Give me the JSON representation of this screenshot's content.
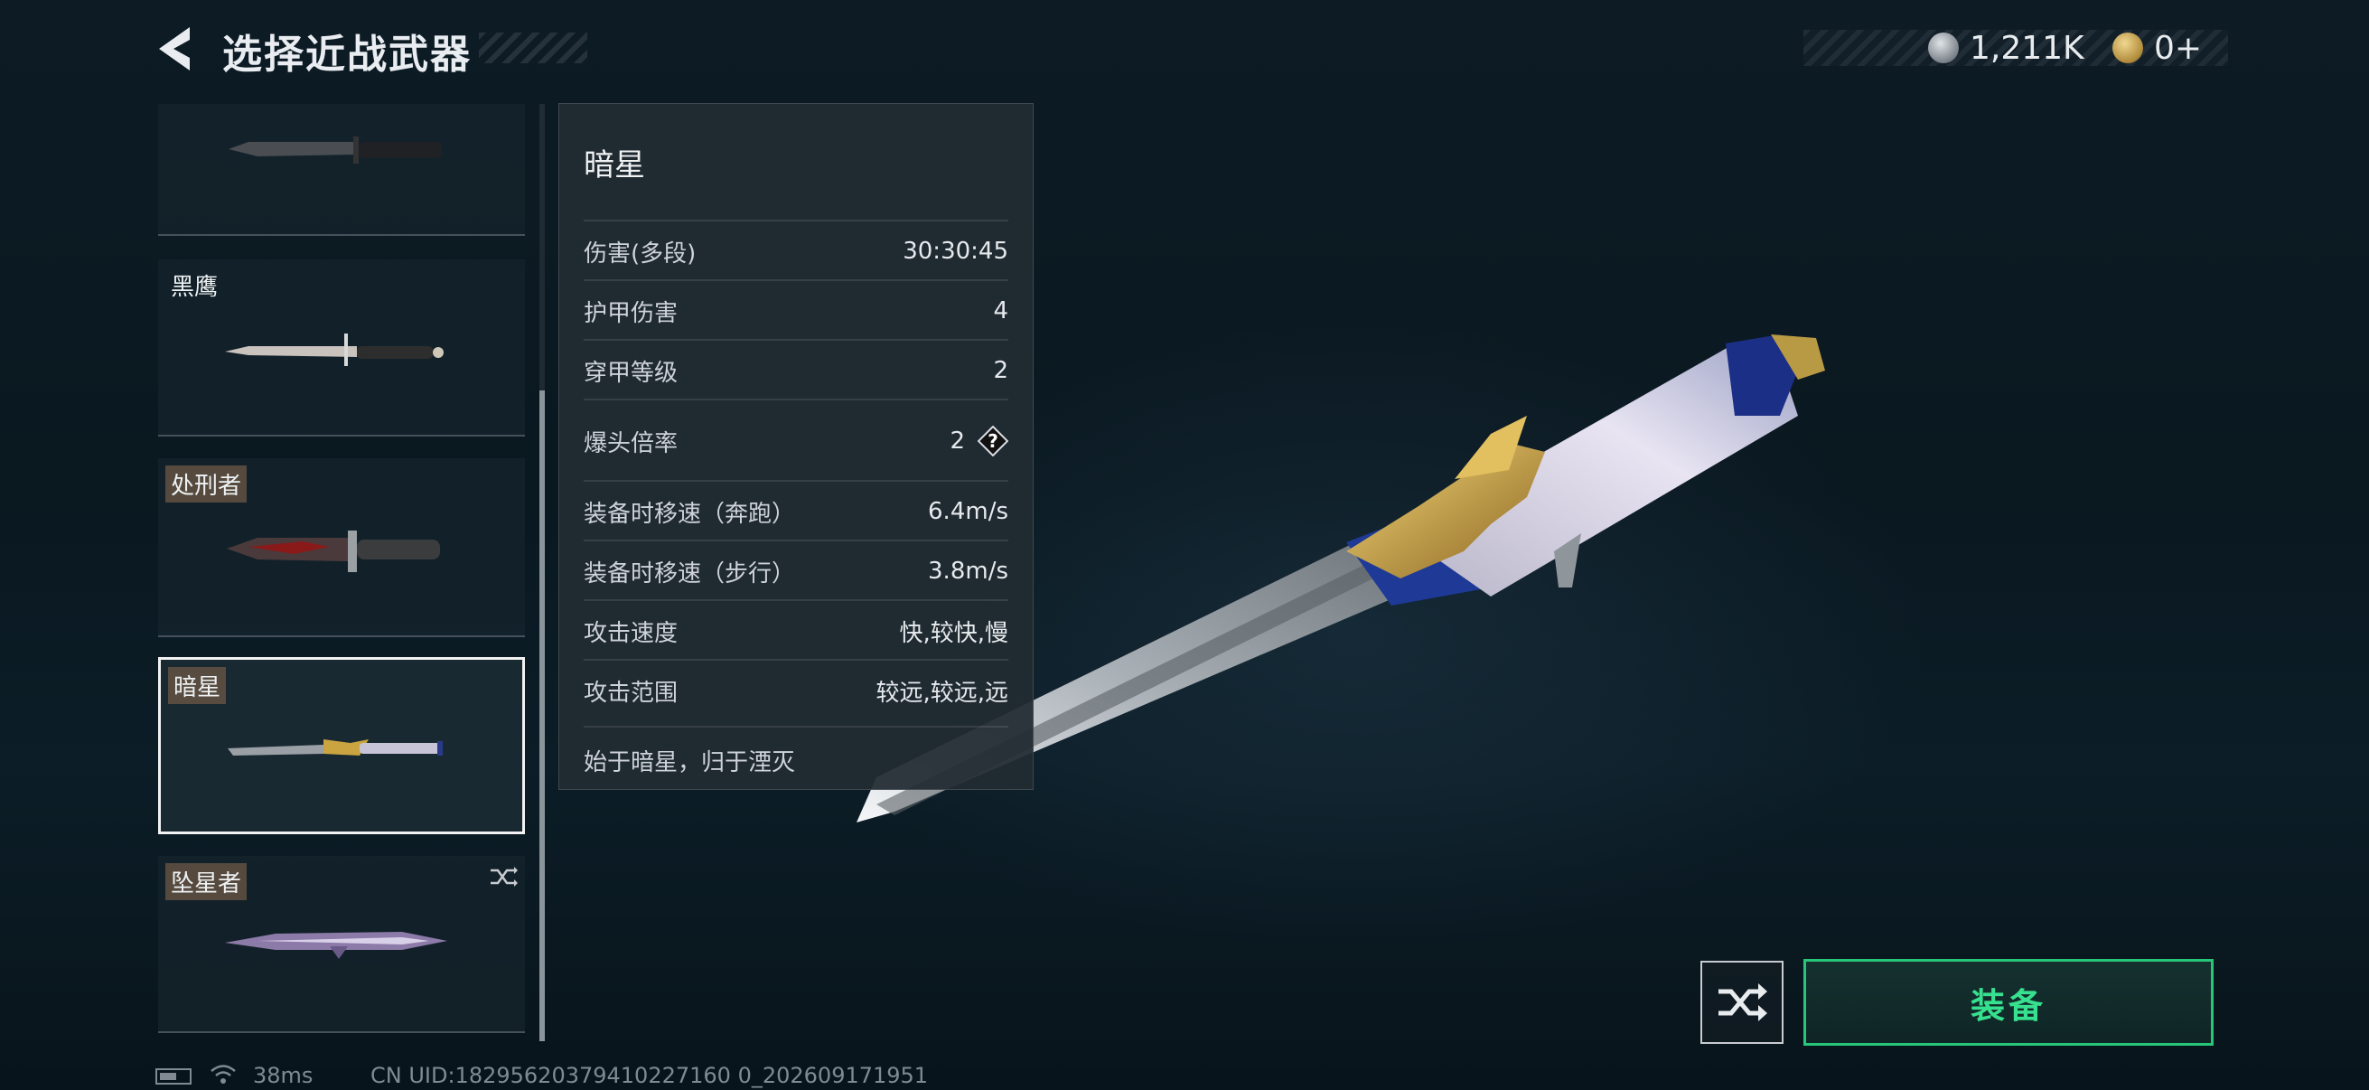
{
  "header": {
    "title": "选择近战武器",
    "currency": [
      {
        "icon": "silver-coin-icon",
        "amount": "1,211K"
      },
      {
        "icon": "gold-triangle-coin-icon",
        "amount": "0+"
      }
    ]
  },
  "weapon_list": [
    {
      "name": "",
      "knife": "tactical-knife"
    },
    {
      "name": "黑鹰",
      "knife": "blackhawk-knife"
    },
    {
      "name": "处刑者",
      "knife": "executioner-knife"
    },
    {
      "name": "暗星",
      "knife": "darkstar-knife",
      "selected": true
    },
    {
      "name": "坠星者",
      "knife": "starfaller-knife"
    }
  ],
  "detail": {
    "name": "暗星",
    "stats": [
      {
        "label": "伤害(多段)",
        "value": "30:30:45"
      },
      {
        "label": "护甲伤害",
        "value": "4"
      },
      {
        "label": "穿甲等级",
        "value": "2"
      },
      {
        "label": "爆头倍率",
        "value": "2"
      },
      {
        "label": "装备时移速（奔跑）",
        "value": "6.4m/s"
      },
      {
        "label": "装备时移速（步行）",
        "value": "3.8m/s"
      },
      {
        "label": "攻击速度",
        "value": "快,较快,慢"
      },
      {
        "label": "攻击范围",
        "value": "较远,较远,远"
      }
    ],
    "description": "始于暗星，归于湮灭"
  },
  "buttons": {
    "equip_label": "装备"
  },
  "footer": {
    "ping": "38ms",
    "uid": "CN UID:18295620379410227160 0_202609171951"
  },
  "colors": {
    "accent_green": "#37e08f",
    "equip_border": "#27c77a",
    "panel_bg": "#222c32"
  }
}
